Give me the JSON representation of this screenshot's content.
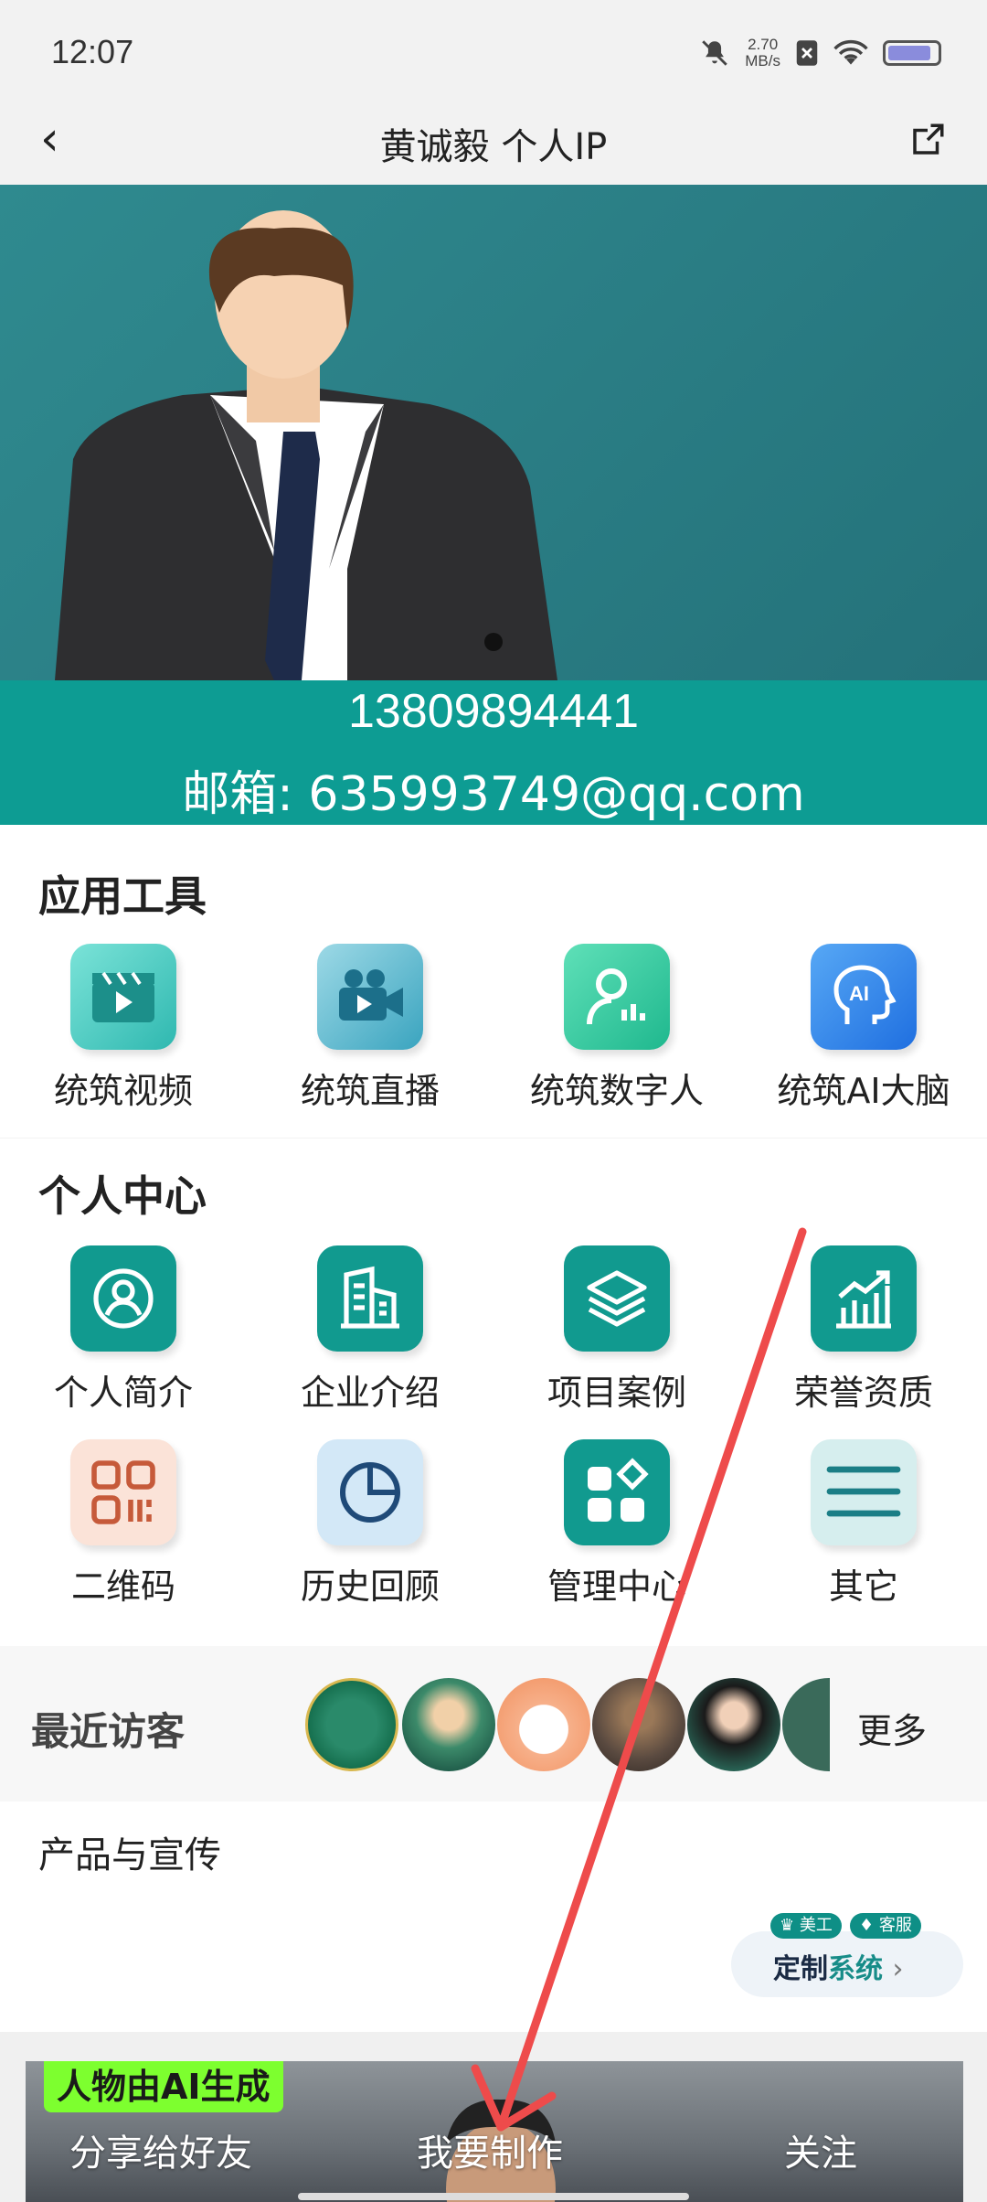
{
  "status_bar": {
    "time": "12:07",
    "speed_value": "2.70",
    "speed_unit": "MB/s"
  },
  "header": {
    "title": "黄诚毅 个人IP"
  },
  "hero": {
    "phone": "13809894441",
    "email": "邮箱: 635993749@qq.com"
  },
  "tools": {
    "title": "应用工具",
    "items": [
      {
        "label": "统筑视频",
        "icon": "video-clapper-icon"
      },
      {
        "label": "统筑直播",
        "icon": "video-camera-icon"
      },
      {
        "label": "统筑数字人",
        "icon": "digital-human-icon"
      },
      {
        "label": "统筑AI大脑",
        "icon": "ai-brain-icon"
      }
    ]
  },
  "personal": {
    "title": "个人中心",
    "items": [
      {
        "label": "个人简介",
        "icon": "person-icon"
      },
      {
        "label": "企业介绍",
        "icon": "building-icon"
      },
      {
        "label": "项目案例",
        "icon": "layers-icon"
      },
      {
        "label": "荣誉资质",
        "icon": "chart-growth-icon"
      },
      {
        "label": "二维码",
        "icon": "qr-code-icon"
      },
      {
        "label": "历史回顾",
        "icon": "pie-clock-icon"
      },
      {
        "label": "管理中心",
        "icon": "grid-manage-icon"
      },
      {
        "label": "其它",
        "icon": "menu-lines-icon"
      }
    ]
  },
  "visitors": {
    "title": "最近访客",
    "more": "更多"
  },
  "products": {
    "title": "产品与宣传",
    "custom_prefix": "定制",
    "custom_suffix": "系统",
    "badge_1": "美工",
    "badge_2": "客服"
  },
  "bottom": {
    "ai_tag": "人物由AI生成",
    "share": "分享给好友",
    "make": "我要制作",
    "follow": "关注"
  },
  "colors": {
    "teal": "#0d9c93",
    "hero": "#2b7f86",
    "arrow": "#ee4b4b"
  }
}
